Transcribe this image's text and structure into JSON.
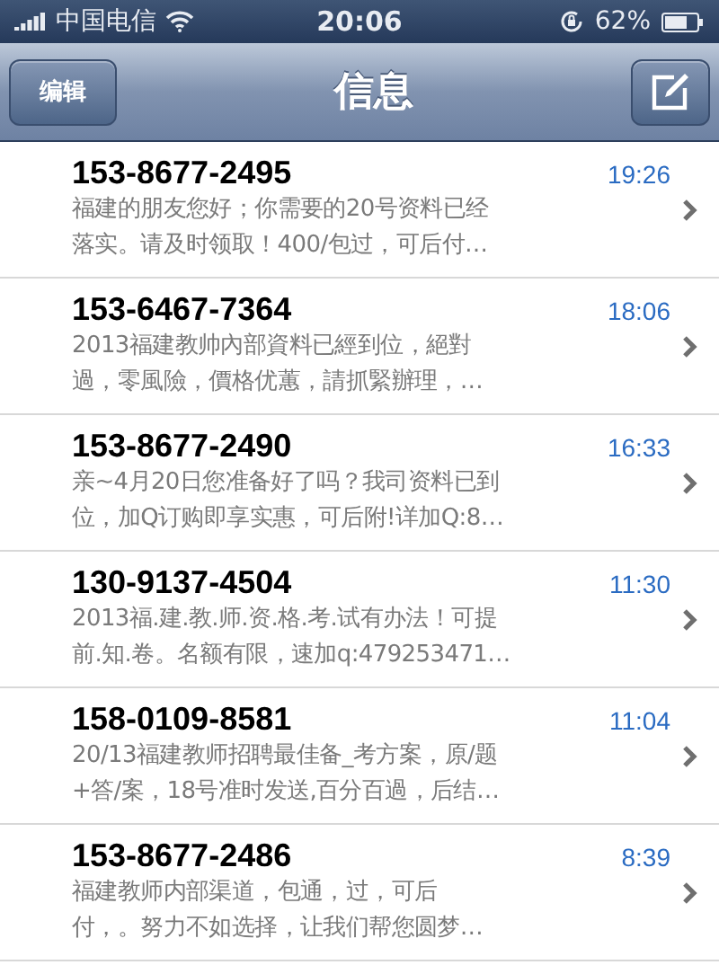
{
  "status_bar": {
    "carrier": "中国电信",
    "time": "20:06",
    "battery": "62%"
  },
  "nav_bar": {
    "edit_button": "编辑",
    "title": "信息"
  },
  "messages": [
    {
      "sender": "153-8677-2495",
      "time": "19:26",
      "preview_lines": [
        "福建的朋友您好；你需要的20号资料已经",
        "落实。请及时领取！400/包过，可后付…"
      ]
    },
    {
      "sender": "153-6467-7364",
      "time": "18:06",
      "preview_lines": [
        "2013福建教帅內部資料已經到位，絕對",
        "過，零風險，價格优蕙，請抓緊辦理，…"
      ]
    },
    {
      "sender": "153-8677-2490",
      "time": "16:33",
      "preview_lines": [
        "亲~4月20日您准备好了吗？我司资料已到",
        "位，加Q订购即享实惠，可后附!详加Q:8…"
      ]
    },
    {
      "sender": "130-9137-4504",
      "time": "11:30",
      "preview_lines": [
        "2013福.建.教.师.资.格.考.试有办法！可提",
        "前.知.卷。名额有限，速加q:479253471…"
      ]
    },
    {
      "sender": "158-0109-8581",
      "time": "11:04",
      "preview_lines": [
        "20/13福建教师招聘最佳备_考方案，原/题",
        "+答/案，18号准时发送,百分百過，后结…"
      ]
    },
    {
      "sender": "153-8677-2486",
      "time": "8:39",
      "preview_lines": [
        "福建教师内部渠道，包通，过，可后",
        "付，。努力不如选择，让我们帮您圆梦…"
      ]
    }
  ]
}
